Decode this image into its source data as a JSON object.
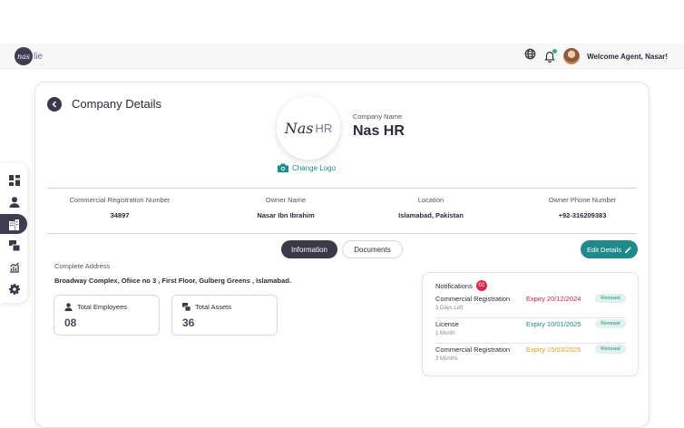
{
  "topbar": {
    "brand_mark": "nas",
    "brand_suffix": "lie",
    "welcome": "Welcome Agent, Nasar!"
  },
  "sidebar": {
    "items": [
      {
        "icon": "dashboard-icon",
        "active": false
      },
      {
        "icon": "user-icon",
        "active": false
      },
      {
        "icon": "building-icon",
        "active": true
      },
      {
        "icon": "assets-icon",
        "active": false
      },
      {
        "icon": "analytics-icon",
        "active": false
      },
      {
        "icon": "gear-icon",
        "active": false
      }
    ]
  },
  "page": {
    "title": "Company Details"
  },
  "company": {
    "logo_mark": "Nas",
    "logo_suffix": "HR",
    "change_logo": "Change Logo",
    "name_label": "Company Name",
    "name": "Nas HR"
  },
  "info": [
    {
      "label": "Commercial Registration Number",
      "value": "34897"
    },
    {
      "label": "Owner Name",
      "value": "Nasar Ibn Ibrahim"
    },
    {
      "label": "Location",
      "value": "Islamabad, Pakistan"
    },
    {
      "label": "Owner Phone Number",
      "value": "+92-316209383"
    }
  ],
  "tabs": {
    "information": "Information",
    "documents": "Documents",
    "active": "information"
  },
  "actions": {
    "edit": "Edit Details"
  },
  "address": {
    "label": "Complete Address",
    "value": "Broadway Complex, Ofiice no 3 , First Floor, Gulberg Greens , Islamabad."
  },
  "stats": [
    {
      "label": "Total Employees",
      "value": "08"
    },
    {
      "label": "Total Assets",
      "value": "36"
    }
  ],
  "notifications": {
    "title": "Notifications",
    "count": "02",
    "items": [
      {
        "name": "Commercial Registration",
        "sub": "3 Days Left",
        "expiry": "Expiry 20/12/2024",
        "color": "#d3203f",
        "badge": "Renewal"
      },
      {
        "name": "License",
        "sub": "1 Month",
        "expiry": "Expiry 10/01/2025",
        "color": "#1b8a8a",
        "badge": "Renewal"
      },
      {
        "name": "Commercial Registration",
        "sub": "3 Months",
        "expiry": "Expiry 15/03/2025",
        "color": "#e89a1a",
        "badge": "Renewal"
      }
    ]
  },
  "colors": {
    "primary_dark": "#3a3947",
    "accent_teal": "#1f8a89",
    "danger": "#d3203f",
    "warning": "#e89a1a"
  }
}
